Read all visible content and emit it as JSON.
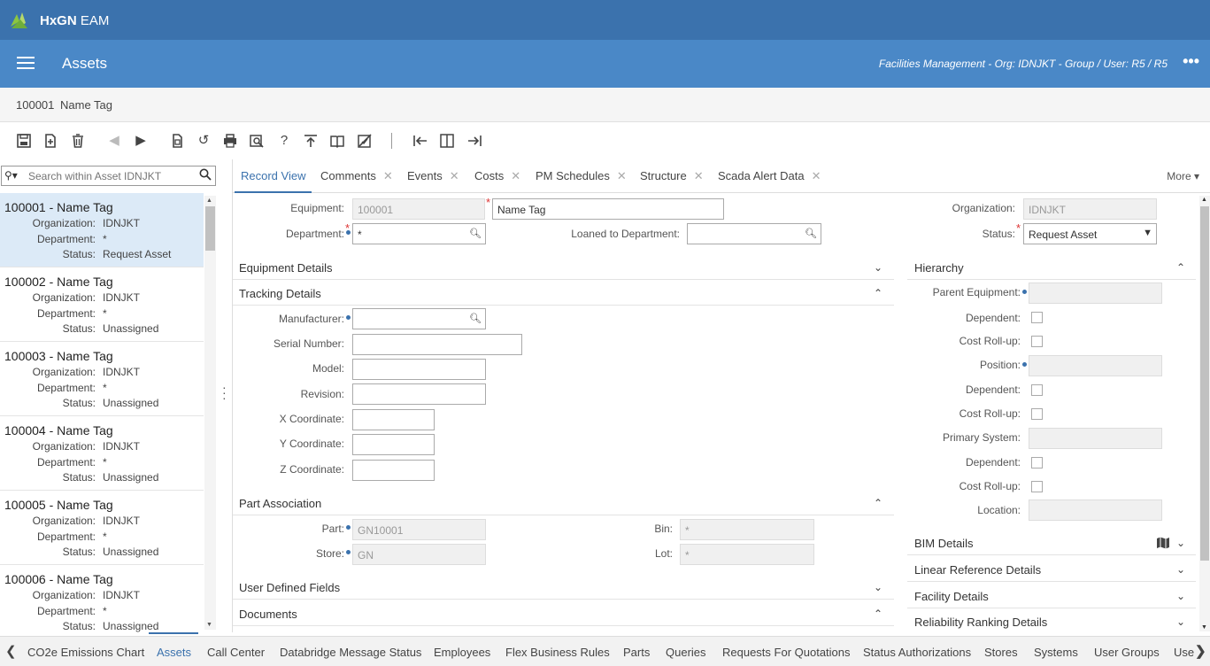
{
  "brand": {
    "name_bold": "HxGN",
    "name_rest": " EAM"
  },
  "appbar": {
    "title": "Assets",
    "context": "Facilities Management - Org: IDNJKT - Group / User: R5 / R5"
  },
  "record": {
    "code": "100001",
    "name": "Name Tag"
  },
  "search": {
    "placeholder": "Search within Asset IDNJKT"
  },
  "list": {
    "labels": {
      "org": "Organization:",
      "dept": "Department:",
      "status": "Status:"
    },
    "items": [
      {
        "title": "100001 - Name Tag",
        "org": "IDNJKT",
        "dept": "*",
        "status": "Request Asset"
      },
      {
        "title": "100002 - Name Tag",
        "org": "IDNJKT",
        "dept": "*",
        "status": "Unassigned"
      },
      {
        "title": "100003 - Name Tag",
        "org": "IDNJKT",
        "dept": "*",
        "status": "Unassigned"
      },
      {
        "title": "100004 - Name Tag",
        "org": "IDNJKT",
        "dept": "*",
        "status": "Unassigned"
      },
      {
        "title": "100005 - Name Tag",
        "org": "IDNJKT",
        "dept": "*",
        "status": "Unassigned"
      },
      {
        "title": "100006 - Name Tag",
        "org": "IDNJKT",
        "dept": "*",
        "status": "Unassigned"
      }
    ]
  },
  "tabs": [
    "Record View",
    "Comments",
    "Events",
    "Costs",
    "PM Schedules",
    "Structure",
    "Scada Alert Data"
  ],
  "more_label": "More",
  "form": {
    "equipment_label": "Equipment:",
    "equipment_value": "100001",
    "description_value": "Name Tag",
    "department_label": "Department:",
    "department_value": "*",
    "loaned_label": "Loaned to Department:",
    "organization_label": "Organization:",
    "organization_value": "IDNJKT",
    "status_label": "Status:",
    "status_value": "Request Asset"
  },
  "sections": {
    "equipment_details": "Equipment Details",
    "tracking_details": "Tracking Details",
    "part_association": "Part Association",
    "user_defined": "User Defined Fields",
    "documents": "Documents",
    "hierarchy": "Hierarchy",
    "bim": "BIM Details",
    "linear": "Linear Reference Details",
    "facility": "Facility Details",
    "reliability": "Reliability Ranking Details"
  },
  "tracking": {
    "manufacturer": "Manufacturer:",
    "serial": "Serial Number:",
    "model": "Model:",
    "revision": "Revision:",
    "x": "X Coordinate:",
    "y": "Y Coordinate:",
    "z": "Z Coordinate:"
  },
  "part": {
    "part_label": "Part:",
    "part_value": "GN10001",
    "store_label": "Store:",
    "store_value": "GN",
    "bin_label": "Bin:",
    "bin_value": "*",
    "lot_label": "Lot:",
    "lot_value": "*"
  },
  "hierarchy": {
    "parent": "Parent Equipment:",
    "dependent": "Dependent:",
    "costrollup": "Cost Roll-up:",
    "position": "Position:",
    "primary": "Primary System:",
    "location": "Location:"
  },
  "bottom_tabs": [
    "CO2e Emissions Chart",
    "Assets",
    "Call Center",
    "Databridge Message Status",
    "Employees",
    "Flex Business Rules",
    "Parts",
    "Queries",
    "Requests For Quotations",
    "Status Authorizations",
    "Stores",
    "Systems",
    "User Groups",
    "Use"
  ],
  "icons": {
    "toolbar": [
      "save-icon",
      "new-record-icon",
      "delete-icon",
      "previous-icon",
      "next-icon",
      "copy-icon",
      "refresh-icon",
      "print-icon",
      "print-preview-icon",
      "help-icon",
      "upload-icon",
      "book-icon",
      "clear-icon",
      "collapse-left-icon",
      "split-view-icon",
      "expand-right-icon"
    ]
  },
  "colors": {
    "topbar": "#3b72ad",
    "appbar": "#4a88c7",
    "accent": "#3b72ad",
    "selected_row": "#dceaf7"
  }
}
